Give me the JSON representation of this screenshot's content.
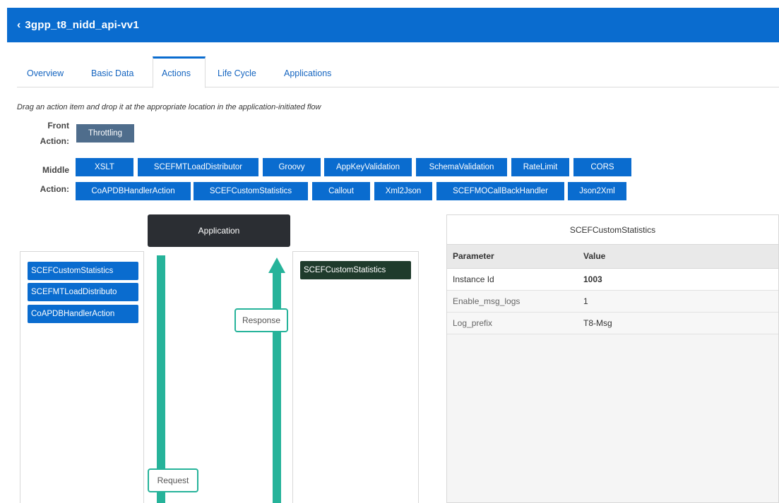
{
  "header": {
    "back_icon": "‹",
    "title": "3gpp_t8_nidd_api-vv1"
  },
  "tabs": [
    {
      "label": "Overview"
    },
    {
      "label": "Basic Data"
    },
    {
      "label": "Actions"
    },
    {
      "label": "Life Cycle"
    },
    {
      "label": "Applications"
    }
  ],
  "active_tab": "Actions",
  "instruction": "Drag an action item and drop it at the appropriate location in the application-initiated flow",
  "front_action": {
    "label_line1": "Front",
    "label_line2": "Action:",
    "items": [
      "Throttling"
    ]
  },
  "middle_action": {
    "label_line1": "Middle",
    "label_line2": "Action:",
    "row1": [
      "XSLT",
      "SCEFMTLoadDistributor",
      "Groovy",
      "AppKeyValidation",
      "SchemaValidation",
      "RateLimit",
      "CORS"
    ],
    "row2": [
      "CoAPDBHandlerAction",
      "SCEFCustomStatistics",
      "Callout",
      "Xml2Json",
      "SCEFMOCallBackHandler",
      "Json2Xml"
    ]
  },
  "flow": {
    "application_label": "Application",
    "request_actions": [
      "SCEFCustomStatistics",
      "SCEFMTLoadDistributo",
      "CoAPDBHandlerAction"
    ],
    "response_actions": [
      "SCEFCustomStatistics"
    ],
    "request_label": "Request",
    "response_label": "Response",
    "arrow_color": "#26b39a"
  },
  "properties": {
    "title": "SCEFCustomStatistics",
    "headers": [
      "Parameter",
      "Value"
    ],
    "rows": [
      {
        "param": "Instance Id",
        "value": "1003"
      },
      {
        "param": "Enable_msg_logs",
        "value": "1"
      },
      {
        "param": "Log_prefix",
        "value": "T8-Msg"
      }
    ]
  },
  "colors": {
    "brand": "#0a6ccf",
    "front_chip": "#4f6d8c",
    "app_box": "#2b2e33",
    "selected_flow_chip": "#1f3b2c"
  }
}
